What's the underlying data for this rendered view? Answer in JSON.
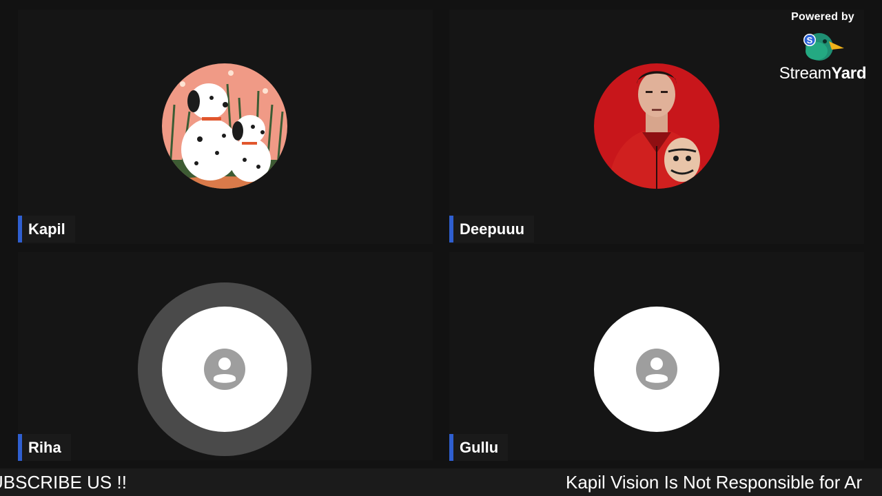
{
  "participants": [
    {
      "name": "Kapil",
      "avatar": "dalmatian-puppies-avatar"
    },
    {
      "name": "Deepuuu",
      "avatar": "money-heist-avatar"
    },
    {
      "name": "Riha",
      "avatar": "default-user-avatar",
      "speaking": true
    },
    {
      "name": "Gullu",
      "avatar": "default-user-avatar"
    }
  ],
  "branding": {
    "powered_by": "Powered by",
    "logo_light": "Stream",
    "logo_heavy": "Yard"
  },
  "ticker": {
    "left_text": "UBSCRIBE US !!",
    "right_text": "Kapil Vision Is Not Responsible for Ar"
  },
  "colors": {
    "background": "#121212",
    "tile": "#151515",
    "name_accent": "#2f5fd0"
  }
}
